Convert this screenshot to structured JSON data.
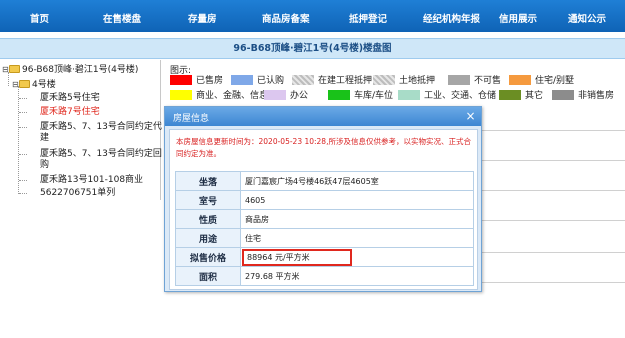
{
  "nav": {
    "items": [
      "首页",
      "在售楼盘",
      "存量房",
      "商品房备案",
      "抵押登记",
      "经纪机构年报",
      "信用展示",
      "通知公示"
    ]
  },
  "page_title": "96-B68顶峰·碧江1号(4号楼)楼盘图",
  "tree": {
    "root": "96-B68顶峰·碧江1号(4号楼)",
    "building": "4号楼",
    "items": [
      "厦禾路5号住宅",
      "厦禾路7号住宅",
      "厦禾路5、7、13号合同约定代建",
      "厦禾路5、7、13号合同约定回购",
      "厦禾路13号101-108商业",
      "5622706751单列"
    ]
  },
  "legend": {
    "heading": "图示:",
    "items": [
      {
        "label": "已售房",
        "color": "#ff0000"
      },
      {
        "label": "已认购",
        "color": "#7fa8e8"
      },
      {
        "label": "在建工程抵押",
        "color": "hatch"
      },
      {
        "label": "土地抵押",
        "color": "hatch"
      },
      {
        "label": "不可售",
        "color": "#a6a6a6"
      },
      {
        "label": "住宅/别墅",
        "color": "#f59a3e"
      },
      {
        "label": "商业、金融、信息",
        "color": "#ffff00"
      },
      {
        "label": "办公",
        "color": "#dcc7ef"
      },
      {
        "label": "车库/车位",
        "color": "#19c219"
      },
      {
        "label": "工业、交通、仓储",
        "color": "#a8dcc8"
      },
      {
        "label": "其它",
        "color": "#6b8e23"
      },
      {
        "label": "非销售房",
        "color": "#8c8c8c"
      }
    ]
  },
  "dialog": {
    "title": "房屋信息",
    "close": "×",
    "notice": "本房屋信息更新时间为：2020-05-23 10:28,所涉及信息仅供参考，以实物实况、正式合同约定为准。",
    "rows": [
      {
        "label": "坐落",
        "value": "厦门嘉宸广场4号楼46跃47层4605室"
      },
      {
        "label": "室号",
        "value": "4605"
      },
      {
        "label": "性质",
        "value": "商品房"
      },
      {
        "label": "用途",
        "value": "住宅"
      },
      {
        "label": "拟售价格",
        "value": "88964 元/平方米"
      },
      {
        "label": "面积",
        "value": "279.68 平方米"
      }
    ]
  },
  "colors": {
    "nav_bg": "#1670c8",
    "title_bg": "#cfe7f8",
    "highlight": "#e0281e"
  }
}
